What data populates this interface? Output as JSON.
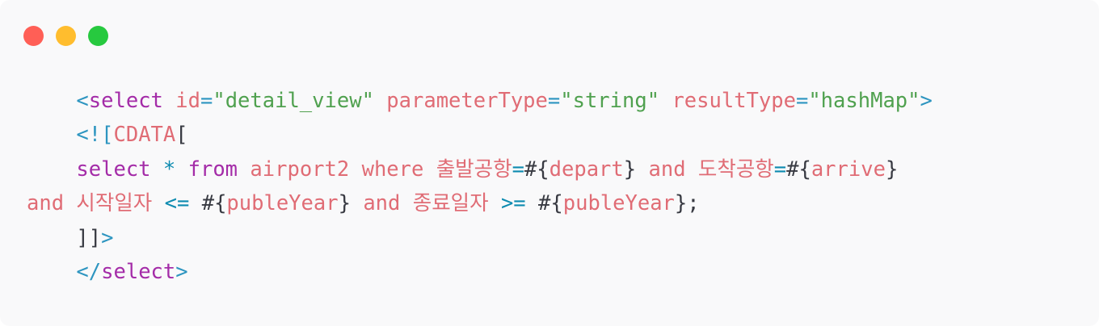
{
  "window": {
    "buttons": {
      "close_color": "#ff5f56",
      "minimize_color": "#ffbd2e",
      "maximize_color": "#27c93f"
    }
  },
  "code": {
    "lines": [
      [
        {
          "t": "    ",
          "c": "plain"
        },
        {
          "t": "<",
          "c": "tag"
        },
        {
          "t": "select",
          "c": "kw"
        },
        {
          "t": " ",
          "c": "plain"
        },
        {
          "t": "id",
          "c": "attr"
        },
        {
          "t": "=",
          "c": "tag"
        },
        {
          "t": "\"detail_view\"",
          "c": "str"
        },
        {
          "t": " ",
          "c": "plain"
        },
        {
          "t": "parameterType",
          "c": "attr"
        },
        {
          "t": "=",
          "c": "tag"
        },
        {
          "t": "\"string\"",
          "c": "str"
        },
        {
          "t": " ",
          "c": "plain"
        },
        {
          "t": "resultType",
          "c": "attr"
        },
        {
          "t": "=",
          "c": "tag"
        },
        {
          "t": "\"hashMap\"",
          "c": "str"
        },
        {
          "t": ">",
          "c": "tag"
        }
      ],
      [
        {
          "t": "    ",
          "c": "plain"
        },
        {
          "t": "<![",
          "c": "tag"
        },
        {
          "t": "CDATA",
          "c": "attr"
        },
        {
          "t": "[",
          "c": "plain"
        }
      ],
      [
        {
          "t": "    ",
          "c": "plain"
        },
        {
          "t": "select",
          "c": "kw"
        },
        {
          "t": " ",
          "c": "plain"
        },
        {
          "t": "*",
          "c": "op"
        },
        {
          "t": " ",
          "c": "plain"
        },
        {
          "t": "from",
          "c": "kw"
        },
        {
          "t": " ",
          "c": "plain"
        },
        {
          "t": "airport2",
          "c": "attr"
        },
        {
          "t": " ",
          "c": "plain"
        },
        {
          "t": "where",
          "c": "attr"
        },
        {
          "t": " ",
          "c": "plain"
        },
        {
          "t": "출발공항",
          "c": "attr"
        },
        {
          "t": "=",
          "c": "op"
        },
        {
          "t": "#",
          "c": "plain"
        },
        {
          "t": "{",
          "c": "plain"
        },
        {
          "t": "depart",
          "c": "attr"
        },
        {
          "t": "}",
          "c": "plain"
        },
        {
          "t": " ",
          "c": "plain"
        },
        {
          "t": "and",
          "c": "attr"
        },
        {
          "t": " ",
          "c": "plain"
        },
        {
          "t": "도착공항",
          "c": "attr"
        },
        {
          "t": "=",
          "c": "op"
        },
        {
          "t": "#",
          "c": "plain"
        },
        {
          "t": "{",
          "c": "plain"
        },
        {
          "t": "arrive",
          "c": "attr"
        },
        {
          "t": "}",
          "c": "plain"
        }
      ],
      [
        {
          "t": "and",
          "c": "attr"
        },
        {
          "t": " ",
          "c": "plain"
        },
        {
          "t": "시작일자",
          "c": "attr"
        },
        {
          "t": " ",
          "c": "plain"
        },
        {
          "t": "<=",
          "c": "op"
        },
        {
          "t": " ",
          "c": "plain"
        },
        {
          "t": "#",
          "c": "plain"
        },
        {
          "t": "{",
          "c": "plain"
        },
        {
          "t": "publeYear",
          "c": "attr"
        },
        {
          "t": "}",
          "c": "plain"
        },
        {
          "t": " ",
          "c": "plain"
        },
        {
          "t": "and",
          "c": "attr"
        },
        {
          "t": " ",
          "c": "plain"
        },
        {
          "t": "종료일자",
          "c": "attr"
        },
        {
          "t": " ",
          "c": "plain"
        },
        {
          "t": ">=",
          "c": "op"
        },
        {
          "t": " ",
          "c": "plain"
        },
        {
          "t": "#",
          "c": "plain"
        },
        {
          "t": "{",
          "c": "plain"
        },
        {
          "t": "publeYear",
          "c": "attr"
        },
        {
          "t": "}",
          "c": "plain"
        },
        {
          "t": ";",
          "c": "plain"
        }
      ],
      [
        {
          "t": "    ",
          "c": "plain"
        },
        {
          "t": "]]",
          "c": "plain"
        },
        {
          "t": ">",
          "c": "tag"
        }
      ],
      [
        {
          "t": "    ",
          "c": "plain"
        },
        {
          "t": "</",
          "c": "tag"
        },
        {
          "t": "select",
          "c": "kw"
        },
        {
          "t": ">",
          "c": "tag"
        }
      ]
    ]
  }
}
